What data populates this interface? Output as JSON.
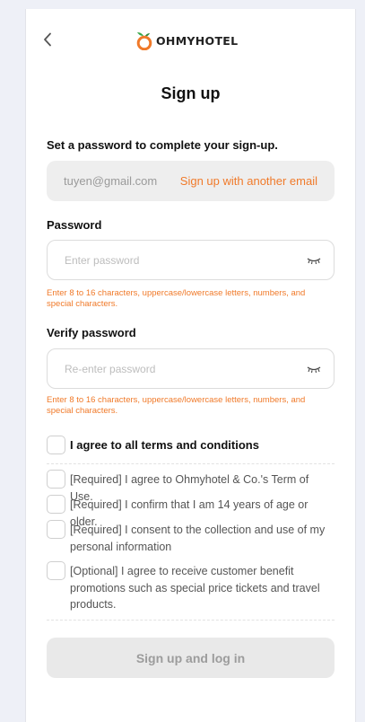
{
  "header": {
    "back_icon": "chevron-left-icon",
    "logo_icon": "orange-fruit-icon",
    "logo_text": "OHMYHOTEL",
    "brand_color": "#f07a2a"
  },
  "page": {
    "title": "Sign up",
    "subtitle": "Set a password to complete your sign-up."
  },
  "email": {
    "value": "tuyen@gmail.com",
    "change_link": "Sign up with another email"
  },
  "password": {
    "label": "Password",
    "placeholder": "Enter password",
    "value": "",
    "toggle_icon": "eye-closed-icon",
    "hint": "Enter 8 to 16 characters, uppercase/lowercase letters, numbers, and special characters."
  },
  "verify_password": {
    "label": "Verify password",
    "placeholder": "Re-enter password",
    "value": "",
    "toggle_icon": "eye-closed-icon",
    "hint": "Enter 8 to 16 characters, uppercase/lowercase letters, numbers, and special characters."
  },
  "agreements": {
    "all_label": "I agree to all terms and conditions",
    "items": [
      {
        "label": "[Required] I agree to Ohmyhotel & Co.'s Term of Use.",
        "checked": false
      },
      {
        "label": "[Required] I confirm that I am 14 years of age or older.",
        "checked": false
      },
      {
        "label": "[Required] I consent to the collection and use of my personal information",
        "checked": false
      },
      {
        "label": "[Optional] I agree to receive customer benefit promotions such as special price tickets and travel products.",
        "checked": false
      }
    ]
  },
  "submit": {
    "label": "Sign up and log in"
  }
}
